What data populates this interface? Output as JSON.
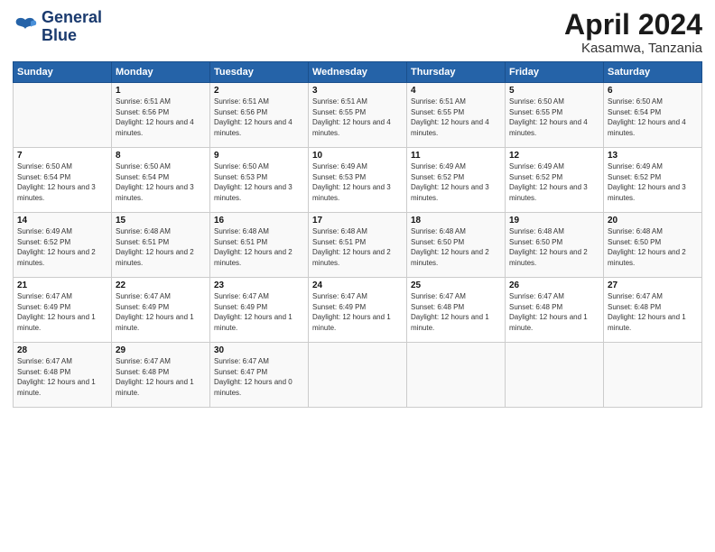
{
  "logo": {
    "line1": "General",
    "line2": "Blue"
  },
  "title": "April 2024",
  "subtitle": "Kasamwa, Tanzania",
  "header": {
    "days": [
      "Sunday",
      "Monday",
      "Tuesday",
      "Wednesday",
      "Thursday",
      "Friday",
      "Saturday"
    ]
  },
  "weeks": [
    [
      {
        "num": "",
        "empty": true
      },
      {
        "num": "1",
        "rise": "6:51 AM",
        "set": "6:56 PM",
        "daylight": "12 hours and 4 minutes."
      },
      {
        "num": "2",
        "rise": "6:51 AM",
        "set": "6:56 PM",
        "daylight": "12 hours and 4 minutes."
      },
      {
        "num": "3",
        "rise": "6:51 AM",
        "set": "6:55 PM",
        "daylight": "12 hours and 4 minutes."
      },
      {
        "num": "4",
        "rise": "6:51 AM",
        "set": "6:55 PM",
        "daylight": "12 hours and 4 minutes."
      },
      {
        "num": "5",
        "rise": "6:50 AM",
        "set": "6:55 PM",
        "daylight": "12 hours and 4 minutes."
      },
      {
        "num": "6",
        "rise": "6:50 AM",
        "set": "6:54 PM",
        "daylight": "12 hours and 4 minutes."
      }
    ],
    [
      {
        "num": "7",
        "rise": "6:50 AM",
        "set": "6:54 PM",
        "daylight": "12 hours and 3 minutes."
      },
      {
        "num": "8",
        "rise": "6:50 AM",
        "set": "6:54 PM",
        "daylight": "12 hours and 3 minutes."
      },
      {
        "num": "9",
        "rise": "6:50 AM",
        "set": "6:53 PM",
        "daylight": "12 hours and 3 minutes."
      },
      {
        "num": "10",
        "rise": "6:49 AM",
        "set": "6:53 PM",
        "daylight": "12 hours and 3 minutes."
      },
      {
        "num": "11",
        "rise": "6:49 AM",
        "set": "6:52 PM",
        "daylight": "12 hours and 3 minutes."
      },
      {
        "num": "12",
        "rise": "6:49 AM",
        "set": "6:52 PM",
        "daylight": "12 hours and 3 minutes."
      },
      {
        "num": "13",
        "rise": "6:49 AM",
        "set": "6:52 PM",
        "daylight": "12 hours and 3 minutes."
      }
    ],
    [
      {
        "num": "14",
        "rise": "6:49 AM",
        "set": "6:52 PM",
        "daylight": "12 hours and 2 minutes."
      },
      {
        "num": "15",
        "rise": "6:48 AM",
        "set": "6:51 PM",
        "daylight": "12 hours and 2 minutes."
      },
      {
        "num": "16",
        "rise": "6:48 AM",
        "set": "6:51 PM",
        "daylight": "12 hours and 2 minutes."
      },
      {
        "num": "17",
        "rise": "6:48 AM",
        "set": "6:51 PM",
        "daylight": "12 hours and 2 minutes."
      },
      {
        "num": "18",
        "rise": "6:48 AM",
        "set": "6:50 PM",
        "daylight": "12 hours and 2 minutes."
      },
      {
        "num": "19",
        "rise": "6:48 AM",
        "set": "6:50 PM",
        "daylight": "12 hours and 2 minutes."
      },
      {
        "num": "20",
        "rise": "6:48 AM",
        "set": "6:50 PM",
        "daylight": "12 hours and 2 minutes."
      }
    ],
    [
      {
        "num": "21",
        "rise": "6:47 AM",
        "set": "6:49 PM",
        "daylight": "12 hours and 1 minute."
      },
      {
        "num": "22",
        "rise": "6:47 AM",
        "set": "6:49 PM",
        "daylight": "12 hours and 1 minute."
      },
      {
        "num": "23",
        "rise": "6:47 AM",
        "set": "6:49 PM",
        "daylight": "12 hours and 1 minute."
      },
      {
        "num": "24",
        "rise": "6:47 AM",
        "set": "6:49 PM",
        "daylight": "12 hours and 1 minute."
      },
      {
        "num": "25",
        "rise": "6:47 AM",
        "set": "6:48 PM",
        "daylight": "12 hours and 1 minute."
      },
      {
        "num": "26",
        "rise": "6:47 AM",
        "set": "6:48 PM",
        "daylight": "12 hours and 1 minute."
      },
      {
        "num": "27",
        "rise": "6:47 AM",
        "set": "6:48 PM",
        "daylight": "12 hours and 1 minute."
      }
    ],
    [
      {
        "num": "28",
        "rise": "6:47 AM",
        "set": "6:48 PM",
        "daylight": "12 hours and 1 minute."
      },
      {
        "num": "29",
        "rise": "6:47 AM",
        "set": "6:48 PM",
        "daylight": "12 hours and 1 minute."
      },
      {
        "num": "30",
        "rise": "6:47 AM",
        "set": "6:47 PM",
        "daylight": "12 hours and 0 minutes."
      },
      {
        "num": "",
        "empty": true
      },
      {
        "num": "",
        "empty": true
      },
      {
        "num": "",
        "empty": true
      },
      {
        "num": "",
        "empty": true
      }
    ]
  ]
}
